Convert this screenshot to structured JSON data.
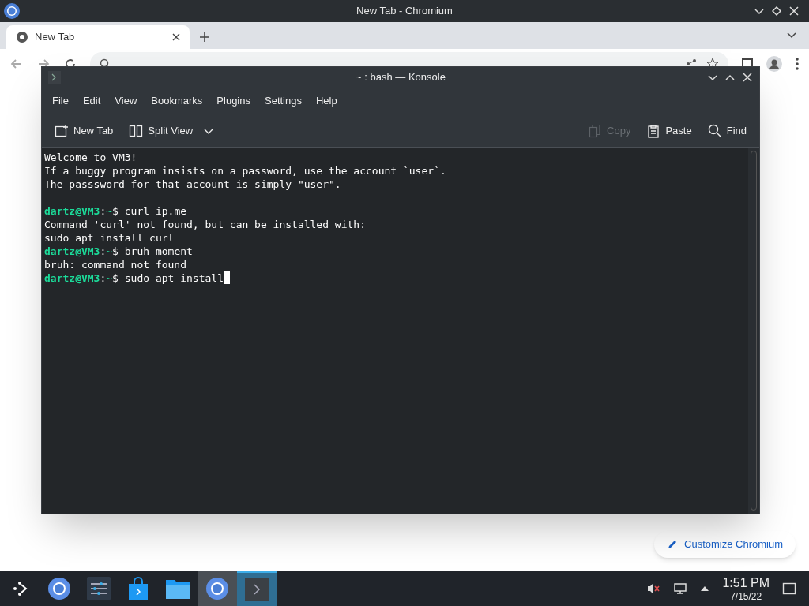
{
  "browser": {
    "window_title": "New Tab - Chromium",
    "tabs": [
      {
        "label": "New Tab",
        "selected": true
      }
    ],
    "customize_button": "Customize Chromium"
  },
  "konsole": {
    "title": "~ : bash — Konsole",
    "menu": [
      "File",
      "Edit",
      "View",
      "Bookmarks",
      "Plugins",
      "Settings",
      "Help"
    ],
    "toolbar": [
      {
        "kind": "newtab",
        "label": "New Tab",
        "disabled": false
      },
      {
        "kind": "split",
        "label": "Split View",
        "disabled": false
      },
      {
        "kind": "copy",
        "label": "Copy",
        "disabled": true
      },
      {
        "kind": "paste",
        "label": "Paste",
        "disabled": false
      },
      {
        "kind": "find",
        "label": "Find",
        "disabled": false
      }
    ],
    "lines": [
      {
        "kind": "output",
        "text": "Welcome to VM3!"
      },
      {
        "kind": "output",
        "text": "If a buggy program insists on a password, use the account `user`."
      },
      {
        "kind": "output",
        "text": "The passsword for that account is simply \"user\"."
      },
      {
        "kind": "blank"
      },
      {
        "kind": "prompt",
        "user": "dartz@VM3",
        "sep": ":",
        "cwd": "~",
        "command": "$ curl ip.me",
        "cursor": false
      },
      {
        "kind": "output",
        "text": "Command 'curl' not found, but can be installed with:"
      },
      {
        "kind": "output",
        "text": "sudo apt install curl"
      },
      {
        "kind": "prompt",
        "user": "dartz@VM3",
        "sep": ":",
        "cwd": "~",
        "command": "$ bruh moment",
        "cursor": false
      },
      {
        "kind": "output",
        "text": "bruh: command not found"
      },
      {
        "kind": "prompt",
        "user": "dartz@VM3",
        "sep": ":",
        "cwd": "~",
        "command": "$ sudo apt install",
        "cursor": true
      }
    ]
  },
  "taskbar": {
    "apps": [
      {
        "kind": "launcher",
        "selected": false
      },
      {
        "kind": "chromium",
        "selected": false
      },
      {
        "kind": "settings",
        "selected": false
      },
      {
        "kind": "store",
        "selected": false
      },
      {
        "kind": "files",
        "selected": false
      },
      {
        "kind": "chromium",
        "selected": true
      },
      {
        "kind": "konsole",
        "selected": true
      }
    ],
    "time": "1:51 PM",
    "date": "7/15/22"
  }
}
